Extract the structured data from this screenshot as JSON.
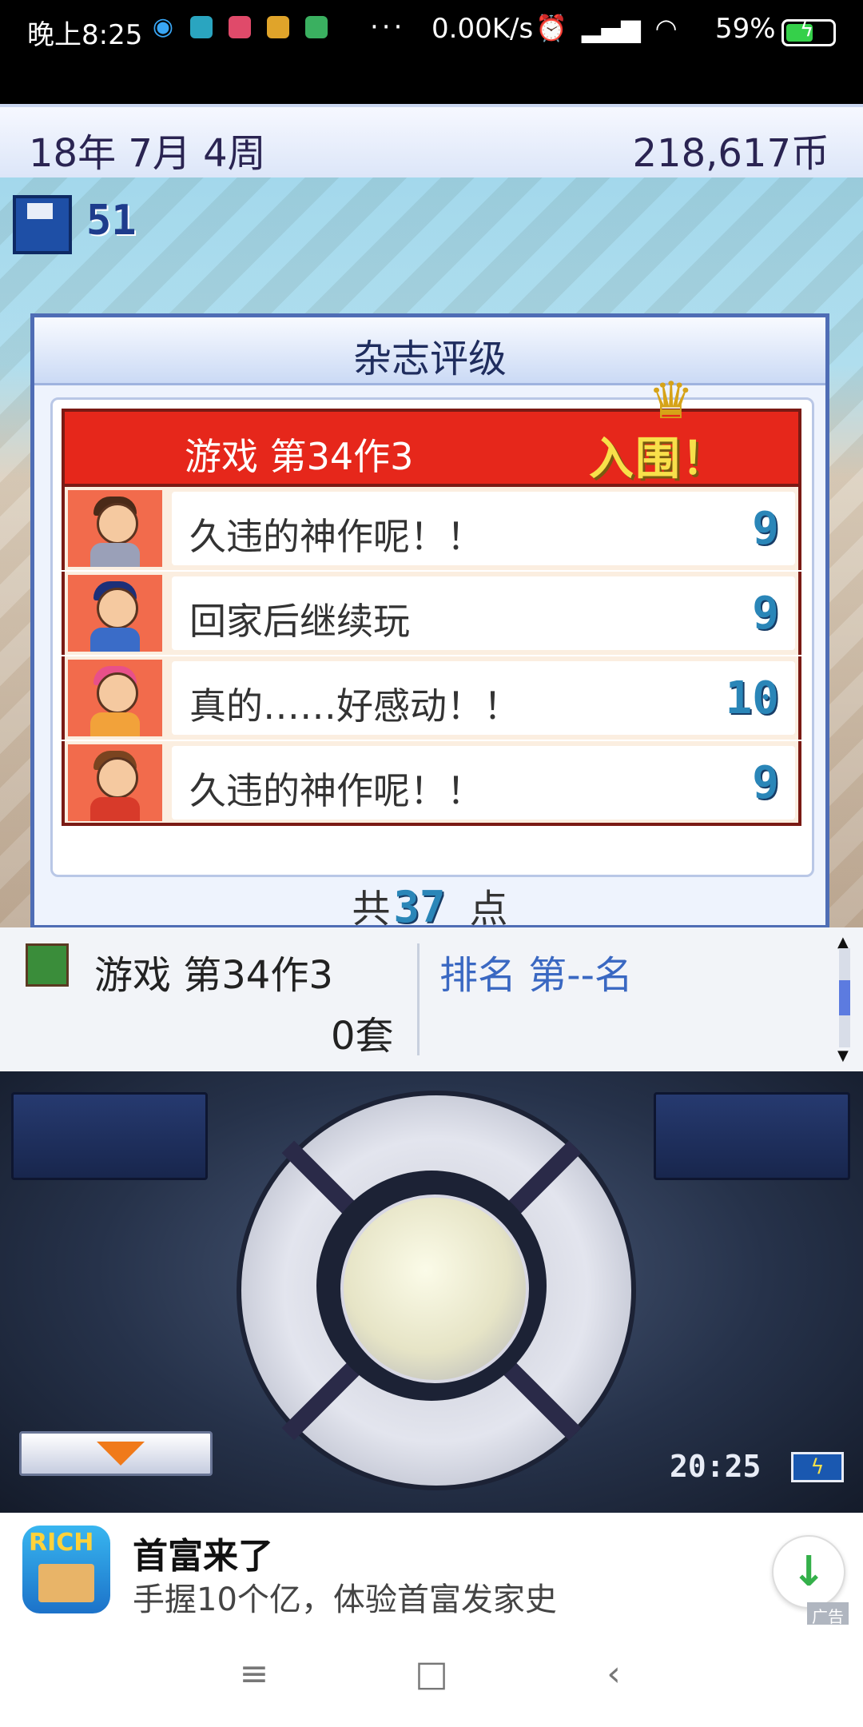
{
  "status_bar": {
    "time": "晚上8:25",
    "more": "···",
    "network_speed": "0.00K/s",
    "battery": "59%",
    "battery_level": 0.59
  },
  "game_header": {
    "date": "18年 7月 4周",
    "coins": "218,617币"
  },
  "scene": {
    "save_count": "51"
  },
  "review_dialog": {
    "title": "杂志评级",
    "game_name": "游戏 第34作3",
    "badge": "入围！",
    "reviews": [
      {
        "comment": "久违的神作呢！！",
        "score": "9",
        "hair": "#4a2a18",
        "shirt": "#9aa0b8"
      },
      {
        "comment": "回家后继续玩",
        "score": "9",
        "hair": "#1c2f78",
        "shirt": "#3a6cc8"
      },
      {
        "comment": "真的……好感动！！",
        "score": "10",
        "hair": "#e8508a",
        "shirt": "#f2a23a"
      },
      {
        "comment": "久违的神作呢！！",
        "score": "9",
        "hair": "#7a4420",
        "shirt": "#d83a2a"
      }
    ],
    "total_prefix": "共",
    "total_points": "37",
    "total_suffix": "点"
  },
  "info_panel": {
    "game_title": "游戏 第34作3",
    "sales": "0套",
    "rank": "排名 第--名"
  },
  "controller": {
    "clock": "20:25"
  },
  "ad": {
    "icon_text": "RICH",
    "title": "首富来了",
    "description": "手握10个亿，体验首富发家史",
    "label": "广告"
  },
  "colors": {
    "ribbon": "#e6271b",
    "score": "#2a86b8",
    "rank": "#3a68c2",
    "header_text": "#2a2452"
  }
}
